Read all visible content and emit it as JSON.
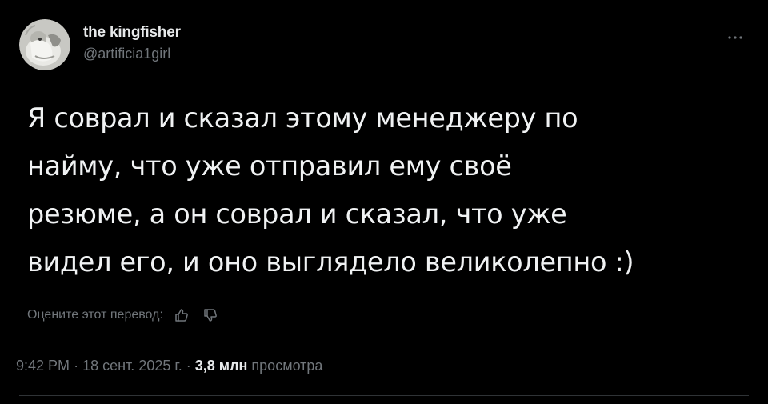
{
  "author": {
    "display_name": "the kingfisher",
    "handle": "@artificia1girl"
  },
  "tweet": {
    "lines": [
      "Я соврал и сказал этому менеджеру по",
      "найму, что уже отправил ему своё",
      "резюме, а он соврал и сказал, что уже",
      "видел его, и оно выглядело великолепно :)"
    ]
  },
  "translation": {
    "rate_label": "Оцените этот перевод:"
  },
  "meta": {
    "time": "9:42 PM",
    "date": "18 сент. 2025 г.",
    "separator": "·",
    "views_count": "3,8 млн",
    "views_label": "просмотра"
  },
  "colors": {
    "background": "#000000",
    "text_primary": "#e7e9ea",
    "text_secondary": "#71767b",
    "divider": "#2f3336"
  },
  "icons": {
    "more": "more-horizontal-icon",
    "thumbs_up": "thumbs-up-icon",
    "thumbs_down": "thumbs-down-icon"
  }
}
